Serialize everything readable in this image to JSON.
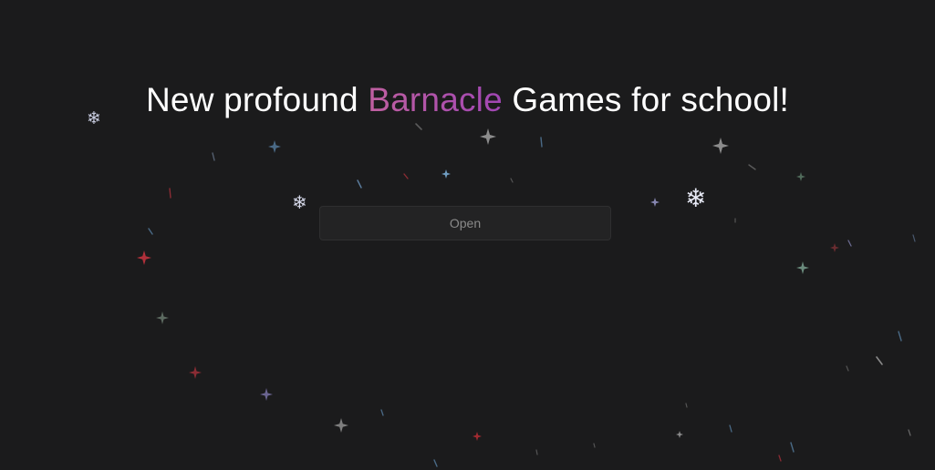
{
  "headline": {
    "before": "New profound ",
    "accent": "Barnacle",
    "after": " Games for school!"
  },
  "open_button": {
    "label": "Open"
  },
  "colors": {
    "background": "#1b1b1c",
    "headline_text": "#ffffff",
    "accent_gradient_start": "#c060a0",
    "accent_gradient_end": "#a046b4",
    "button_background": "#232324",
    "button_text": "#8a8a8a"
  },
  "decorations": {
    "snowflake_icon": "❄",
    "sparkle_icon": "four-point-star"
  }
}
